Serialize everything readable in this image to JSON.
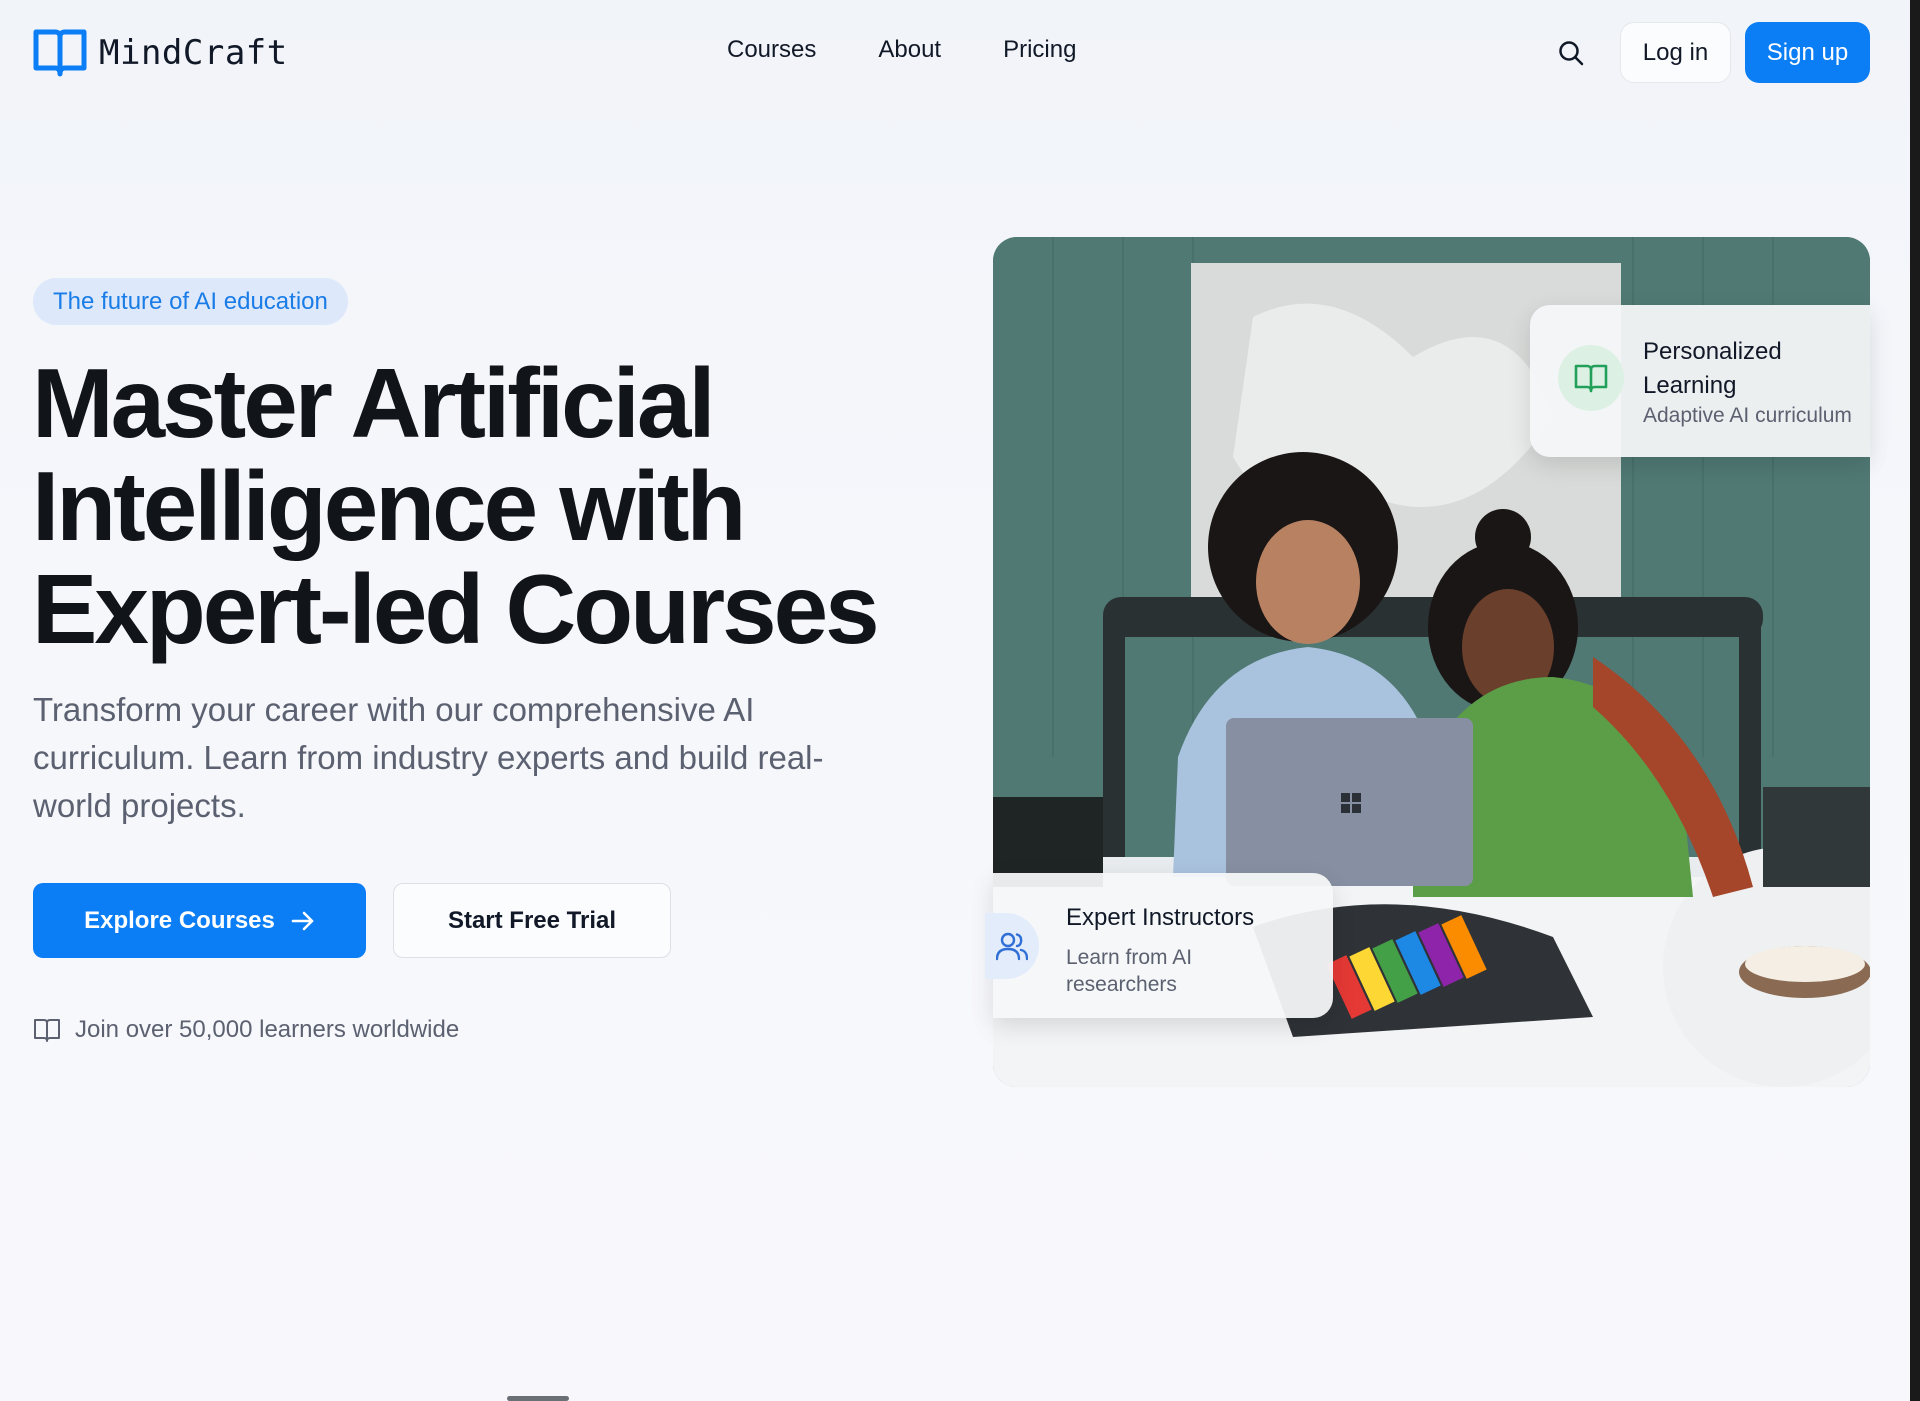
{
  "brand": {
    "name": "MindCraft",
    "accent": "#0b7df5"
  },
  "nav": {
    "items": [
      "Courses",
      "About",
      "Pricing"
    ]
  },
  "header": {
    "login_label": "Log in",
    "signup_label": "Sign up",
    "search_icon": "search-icon"
  },
  "hero": {
    "badge": "The future of AI education",
    "headline": "Master Artificial Intelligence with Expert-led Courses",
    "subtext": "Transform your career with our comprehensive AI curriculum. Learn from industry experts and build real-world projects.",
    "primary_cta": "Explore Courses",
    "secondary_cta": "Start Free Trial",
    "join_text": "Join over 50,000 learners worldwide"
  },
  "cards": {
    "personalized": {
      "title": "Personalized Learning",
      "subtitle": "Adaptive AI curriculum",
      "icon": "book-open-icon"
    },
    "expert": {
      "title": "Expert Instructors",
      "subtitle": "Learn from AI researchers",
      "icon": "users-icon"
    }
  }
}
